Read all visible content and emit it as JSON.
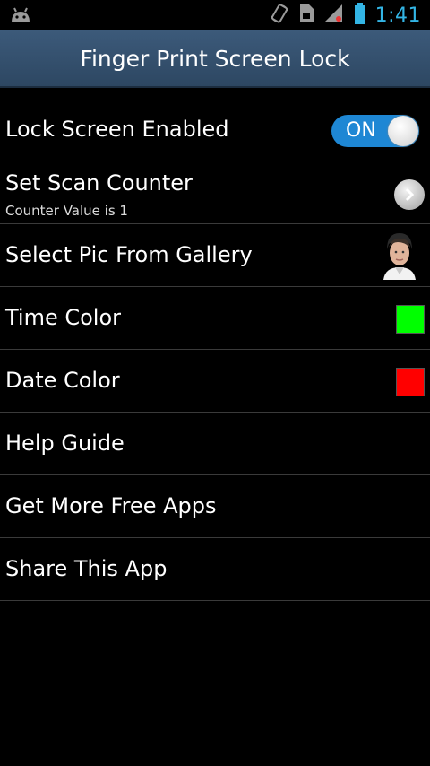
{
  "status_bar": {
    "time": "1:41",
    "icons": [
      "android-debug-icon",
      "rotate-icon",
      "sim-card-icon",
      "signal-icon",
      "battery-icon"
    ]
  },
  "header": {
    "title": "Finger Print Screen Lock"
  },
  "settings": {
    "lock_screen": {
      "label": "Lock Screen Enabled",
      "toggle_label": "ON",
      "enabled": true
    },
    "scan_counter": {
      "label": "Set Scan Counter",
      "summary": "Counter Value is 1"
    },
    "gallery": {
      "label": "Select Pic From Gallery"
    },
    "time_color": {
      "label": "Time Color",
      "color": "#00ff00"
    },
    "date_color": {
      "label": "Date Color",
      "color": "#ff0000"
    },
    "help": {
      "label": "Help Guide"
    },
    "more_apps": {
      "label": "Get More Free Apps"
    },
    "share": {
      "label": "Share This App"
    }
  },
  "colors": {
    "accent": "#33b5e5",
    "toggle_on": "#1e87d4",
    "title_bar": "#34506e"
  }
}
